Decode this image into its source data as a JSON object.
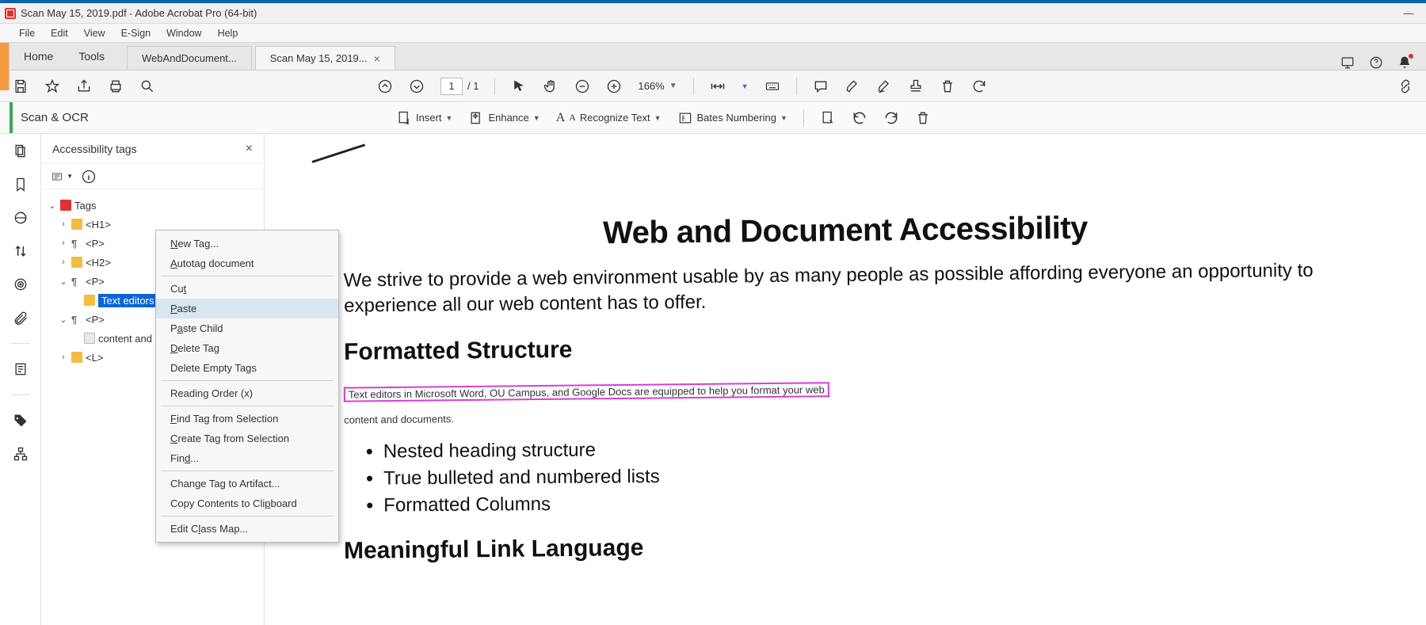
{
  "titlebar": {
    "filename": "Scan May 15, 2019.pdf",
    "app": "Adobe Acrobat Pro (64-bit)"
  },
  "menus": [
    "File",
    "Edit",
    "View",
    "E-Sign",
    "Window",
    "Help"
  ],
  "tabs": {
    "home": "Home",
    "tools": "Tools",
    "docs": [
      "WebAndDocument...",
      "Scan May 15, 2019..."
    ]
  },
  "toolbar1": {
    "page_current": "1",
    "page_total": "/  1",
    "zoom": "166%"
  },
  "toolbar2": {
    "section": "Scan & OCR",
    "buttons": {
      "insert": "Insert",
      "enhance": "Enhance",
      "recognize": "Recognize Text",
      "bates": "Bates Numbering"
    }
  },
  "tagpanel": {
    "title": "Accessibility tags",
    "tree": {
      "root": "Tags",
      "items": [
        {
          "label": "<H1>"
        },
        {
          "label": "<P>"
        },
        {
          "label": "<H2>"
        },
        {
          "label": "<P>",
          "selected_child": "Text editors in"
        },
        {
          "label": "<P>",
          "child": "content and d"
        },
        {
          "label": "<L>"
        }
      ]
    }
  },
  "contextmenu": {
    "items": [
      {
        "label": "New Tag...",
        "u": 0
      },
      {
        "label": "Autotag document",
        "u": 0
      },
      "sep",
      {
        "label": "Cut",
        "u": 2
      },
      {
        "label": "Paste",
        "u": 0,
        "hover": true
      },
      {
        "label": "Paste Child",
        "u": 1
      },
      {
        "label": "Delete Tag",
        "u": 0
      },
      {
        "label": "Delete Empty Tags"
      },
      "sep",
      {
        "label": "Reading Order (x)"
      },
      "sep",
      {
        "label": "Find Tag from Selection",
        "u": 0
      },
      {
        "label": "Create Tag from Selection",
        "u": 0
      },
      {
        "label": "Find...",
        "u": 3
      },
      "sep",
      {
        "label": "Change Tag to Artifact..."
      },
      {
        "label": "Copy Contents to Clipboard",
        "u": 20
      },
      "sep",
      {
        "label": "Edit Class Map...",
        "u": 6
      }
    ]
  },
  "document": {
    "h1": "Web and Document Accessibility",
    "p1": "We strive to provide a web environment usable by as many people as possible affording everyone an opportunity to experience all our web content has to offer.",
    "h2a": "Formatted Structure",
    "p2_hl": "Text editors in Microsoft Word, OU Campus, and Google Docs are equipped to help you format your web",
    "p2_rest": "content and documents.",
    "li1": "Nested heading structure",
    "li2": "True bulleted and numbered lists",
    "li3": "Formatted Columns",
    "h2b": "Meaningful Link Language"
  }
}
